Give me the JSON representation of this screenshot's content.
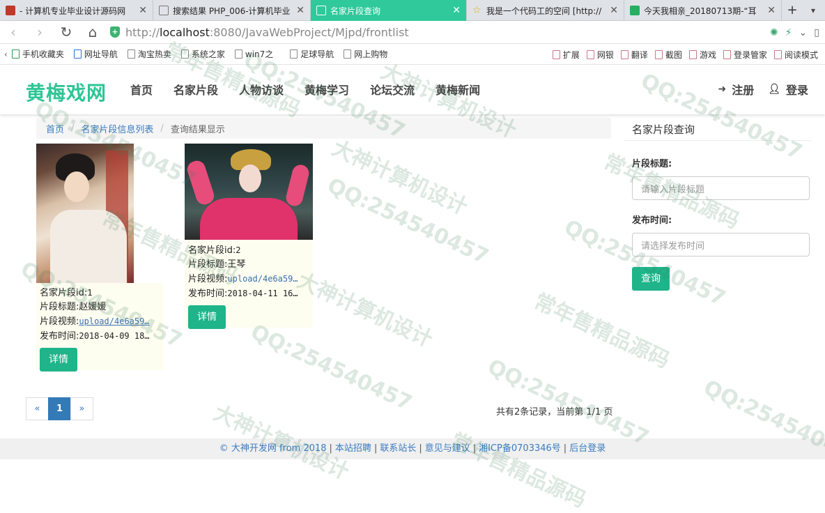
{
  "browser": {
    "tabs": [
      {
        "title": "- 计算机专业毕业设计源码网",
        "icon_color": "#c0392b",
        "active": false
      },
      {
        "title": "搜索结果 PHP_006-计算机毕业",
        "icon_color": "#ffffff",
        "active": false
      },
      {
        "title": "名家片段查询",
        "icon_color": "#ffffff",
        "active": true
      },
      {
        "title": "我是一个代码工的空间 [http://",
        "icon_color": "#f1c40f",
        "active": false
      },
      {
        "title": "今天我相亲_20180713期-“耳",
        "icon_color": "#27ae60",
        "active": false
      }
    ],
    "new_tab": "+",
    "url_prefix": "http://",
    "url_host": "localhost",
    "url_rest": ":8080/JavaWebProject/Mjpd/frontlist",
    "bookmarks": [
      "手机收藏夹",
      "网址导航",
      "淘宝热卖",
      "系统之家",
      "win7之",
      "足球导航",
      "网上购物"
    ],
    "bookmarks_right": [
      "扩展",
      "网银",
      "翻译",
      "截图",
      "游戏",
      "登录管家",
      "阅读模式"
    ]
  },
  "site": {
    "logo": "黄梅戏网",
    "nav": [
      "首页",
      "名家片段",
      "人物访谈",
      "黄梅学习",
      "论坛交流",
      "黄梅新闻"
    ],
    "register": "注册",
    "login": "登录"
  },
  "breadcrumb": {
    "home": "首页",
    "list": "名家片段信息列表",
    "current": "查询结果显示"
  },
  "items": [
    {
      "id_label": "名家片段id:",
      "id": "1",
      "title_label": "片段标题:",
      "title": "赵媛媛",
      "video_label": "片段视频:",
      "video": "upload/4e6a59…",
      "time_label": "发布时间:",
      "time": "2018-04-09 18…",
      "detail_button": "详情"
    },
    {
      "id_label": "名家片段id:",
      "id": "2",
      "title_label": "片段标题:",
      "title": "王琴",
      "video_label": "片段视频:",
      "video": "upload/4e6a59…",
      "time_label": "发布时间:",
      "time": "2018-04-11 16…",
      "detail_button": "详情"
    }
  ],
  "sidebar": {
    "title": "名家片段查询",
    "title_field_label": "片段标题:",
    "title_placeholder": "请输入片段标题",
    "time_field_label": "发布时间:",
    "time_placeholder": "请选择发布时间",
    "query_button": "查询"
  },
  "pagination": {
    "prev": "«",
    "current": "1",
    "next": "»",
    "summary": "共有2条记录，当前第 1/1 页"
  },
  "footer": {
    "links": [
      "© 大神开发网 from 2018",
      "本站招聘",
      "联系站长",
      "意见与建议",
      "湘ICP备0703346号",
      "后台登录"
    ]
  },
  "watermark": {
    "qq": "QQ:254540457",
    "a": "大神计算机设计",
    "b": "常年售精品源码"
  },
  "colors": {
    "accent": "#2ec595",
    "button": "#1fb48a",
    "active_tab": "#2fc99b",
    "link": "#3b7bbf"
  }
}
